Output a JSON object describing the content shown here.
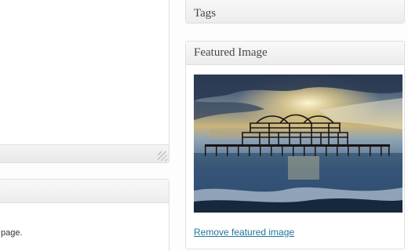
{
  "sidebar": {
    "tags_title": "Tags",
    "featured_image": {
      "title": "Featured Image",
      "remove_link": "Remove featured image"
    }
  },
  "main": {
    "lower_box_text": "page."
  }
}
